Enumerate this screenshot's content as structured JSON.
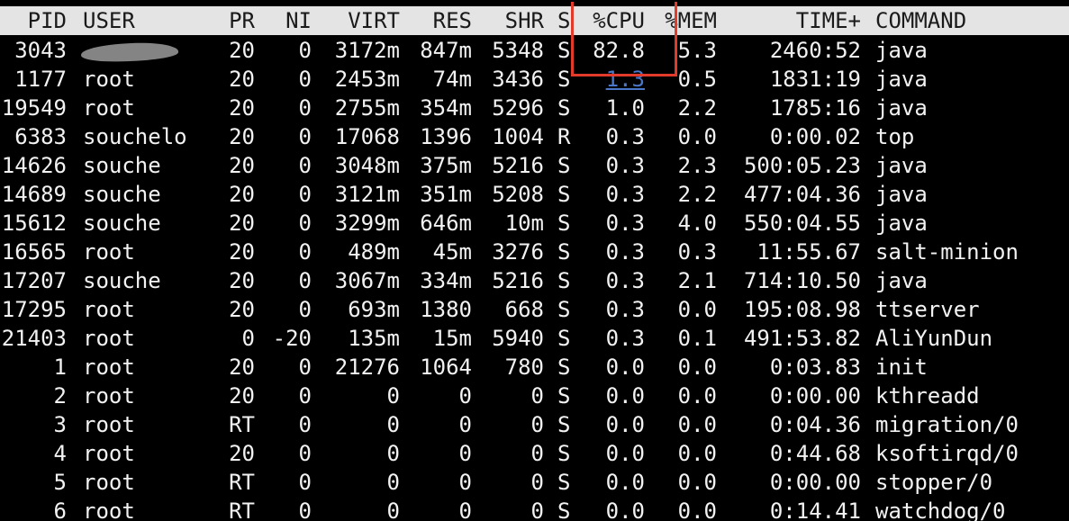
{
  "columns": [
    "PID",
    "USER",
    "PR",
    "NI",
    "VIRT",
    "RES",
    "SHR",
    "S",
    "%CPU",
    "%MEM",
    "TIME+",
    "COMMAND"
  ],
  "processes": [
    {
      "pid": "3043",
      "user": "",
      "pr": "20",
      "ni": "0",
      "virt": "3172m",
      "res": "847m",
      "shr": "5348",
      "s": "S",
      "cpu": "82.8",
      "mem": "5.3",
      "time": "2460:52",
      "command": "java",
      "user_redacted": true
    },
    {
      "pid": "1177",
      "user": "root",
      "pr": "20",
      "ni": "0",
      "virt": "2453m",
      "res": "74m",
      "shr": "3436",
      "s": "S",
      "cpu": "1.3",
      "mem": "0.5",
      "time": "1831:19",
      "command": "java"
    },
    {
      "pid": "19549",
      "user": "root",
      "pr": "20",
      "ni": "0",
      "virt": "2755m",
      "res": "354m",
      "shr": "5296",
      "s": "S",
      "cpu": "1.0",
      "mem": "2.2",
      "time": "1785:16",
      "command": "java"
    },
    {
      "pid": "6383",
      "user": "souchelo",
      "pr": "20",
      "ni": "0",
      "virt": "17068",
      "res": "1396",
      "shr": "1004",
      "s": "R",
      "cpu": "0.3",
      "mem": "0.0",
      "time": "0:00.02",
      "command": "top"
    },
    {
      "pid": "14626",
      "user": "souche",
      "pr": "20",
      "ni": "0",
      "virt": "3048m",
      "res": "375m",
      "shr": "5216",
      "s": "S",
      "cpu": "0.3",
      "mem": "2.3",
      "time": "500:05.23",
      "command": "java"
    },
    {
      "pid": "14689",
      "user": "souche",
      "pr": "20",
      "ni": "0",
      "virt": "3121m",
      "res": "351m",
      "shr": "5208",
      "s": "S",
      "cpu": "0.3",
      "mem": "2.2",
      "time": "477:04.36",
      "command": "java"
    },
    {
      "pid": "15612",
      "user": "souche",
      "pr": "20",
      "ni": "0",
      "virt": "3299m",
      "res": "646m",
      "shr": "10m",
      "s": "S",
      "cpu": "0.3",
      "mem": "4.0",
      "time": "550:04.55",
      "command": "java"
    },
    {
      "pid": "16565",
      "user": "root",
      "pr": "20",
      "ni": "0",
      "virt": "489m",
      "res": "45m",
      "shr": "3276",
      "s": "S",
      "cpu": "0.3",
      "mem": "0.3",
      "time": "11:55.67",
      "command": "salt-minion"
    },
    {
      "pid": "17207",
      "user": "souche",
      "pr": "20",
      "ni": "0",
      "virt": "3067m",
      "res": "334m",
      "shr": "5216",
      "s": "S",
      "cpu": "0.3",
      "mem": "2.1",
      "time": "714:10.50",
      "command": "java"
    },
    {
      "pid": "17295",
      "user": "root",
      "pr": "20",
      "ni": "0",
      "virt": "693m",
      "res": "1380",
      "shr": "668",
      "s": "S",
      "cpu": "0.3",
      "mem": "0.0",
      "time": "195:08.98",
      "command": "ttserver"
    },
    {
      "pid": "21403",
      "user": "root",
      "pr": "0",
      "ni": "-20",
      "virt": "135m",
      "res": "15m",
      "shr": "5940",
      "s": "S",
      "cpu": "0.3",
      "mem": "0.1",
      "time": "491:53.82",
      "command": "AliYunDun"
    },
    {
      "pid": "1",
      "user": "root",
      "pr": "20",
      "ni": "0",
      "virt": "21276",
      "res": "1064",
      "shr": "780",
      "s": "S",
      "cpu": "0.0",
      "mem": "0.0",
      "time": "0:03.83",
      "command": "init"
    },
    {
      "pid": "2",
      "user": "root",
      "pr": "20",
      "ni": "0",
      "virt": "0",
      "res": "0",
      "shr": "0",
      "s": "S",
      "cpu": "0.0",
      "mem": "0.0",
      "time": "0:00.00",
      "command": "kthreadd"
    },
    {
      "pid": "3",
      "user": "root",
      "pr": "RT",
      "ni": "0",
      "virt": "0",
      "res": "0",
      "shr": "0",
      "s": "S",
      "cpu": "0.0",
      "mem": "0.0",
      "time": "0:04.36",
      "command": "migration/0"
    },
    {
      "pid": "4",
      "user": "root",
      "pr": "20",
      "ni": "0",
      "virt": "0",
      "res": "0",
      "shr": "0",
      "s": "S",
      "cpu": "0.0",
      "mem": "0.0",
      "time": "0:44.68",
      "command": "ksoftirqd/0"
    },
    {
      "pid": "5",
      "user": "root",
      "pr": "RT",
      "ni": "0",
      "virt": "0",
      "res": "0",
      "shr": "0",
      "s": "S",
      "cpu": "0.0",
      "mem": "0.0",
      "time": "0:00.00",
      "command": "stopper/0"
    },
    {
      "pid": "6",
      "user": "root",
      "pr": "RT",
      "ni": "0",
      "virt": "0",
      "res": "0",
      "shr": "0",
      "s": "S",
      "cpu": "0.0",
      "mem": "0.0",
      "time": "0:14.41",
      "command": "watchdog/0"
    }
  ],
  "colors": {
    "background": "#000000",
    "text": "#f2f2f2",
    "header_bg": "#e4e4e4",
    "header_text": "#1a1a1a",
    "highlight": "#e23b2b",
    "link": "#4a76c8"
  }
}
